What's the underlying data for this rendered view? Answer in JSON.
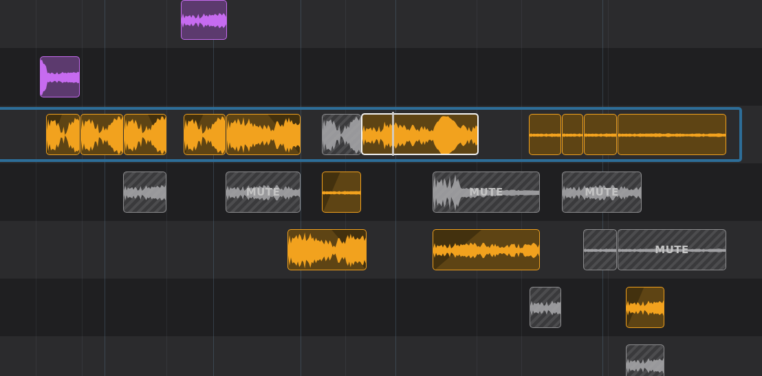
{
  "mute_label": "MUTE",
  "colors": {
    "orange": "#f2a21e",
    "purple": "#c66bf0",
    "muted": "#8d8d8f",
    "selection": "#2d6e99",
    "lane_light": "#2b2b2d",
    "lane_dark": "#1f1f21"
  },
  "tracks": [
    {
      "regions": [
        {
          "color": "purple",
          "wave": "soft"
        }
      ]
    },
    {
      "regions": [
        {
          "color": "purple",
          "wave": "decay"
        }
      ]
    },
    {
      "selected": true,
      "regions": [
        {
          "color": "orange",
          "wave": "dense"
        },
        {
          "color": "orange",
          "wave": "dense"
        },
        {
          "color": "orange",
          "wave": "dense"
        },
        {
          "color": "orange",
          "wave": "dense"
        },
        {
          "color": "orange",
          "wave": "dense"
        },
        {
          "color": "muted",
          "wave": "dense"
        },
        {
          "color": "orange",
          "wave": "swell",
          "selected": true
        },
        {
          "color": "orange",
          "wave": "thin"
        },
        {
          "color": "orange",
          "wave": "thin"
        },
        {
          "color": "orange",
          "wave": "thin"
        },
        {
          "color": "orange",
          "wave": "thin"
        }
      ]
    },
    {
      "regions": [
        {
          "color": "muted",
          "wave": "soft"
        },
        {
          "color": "muted",
          "wave": "soft",
          "label": true
        },
        {
          "color": "orange",
          "wave": "thin"
        },
        {
          "color": "muted",
          "wave": "burst",
          "label": true
        },
        {
          "color": "muted",
          "wave": "soft",
          "label": true
        }
      ]
    },
    {
      "regions": [
        {
          "color": "orange",
          "wave": "dense"
        },
        {
          "color": "orange",
          "wave": "soft"
        },
        {
          "color": "muted",
          "wave": "thin"
        },
        {
          "color": "muted",
          "wave": "thin",
          "label": true
        }
      ]
    },
    {
      "regions": [
        {
          "color": "muted",
          "wave": "soft"
        },
        {
          "color": "orange",
          "wave": "soft"
        }
      ]
    },
    {
      "regions": [
        {
          "color": "muted",
          "wave": "soft"
        }
      ]
    }
  ]
}
